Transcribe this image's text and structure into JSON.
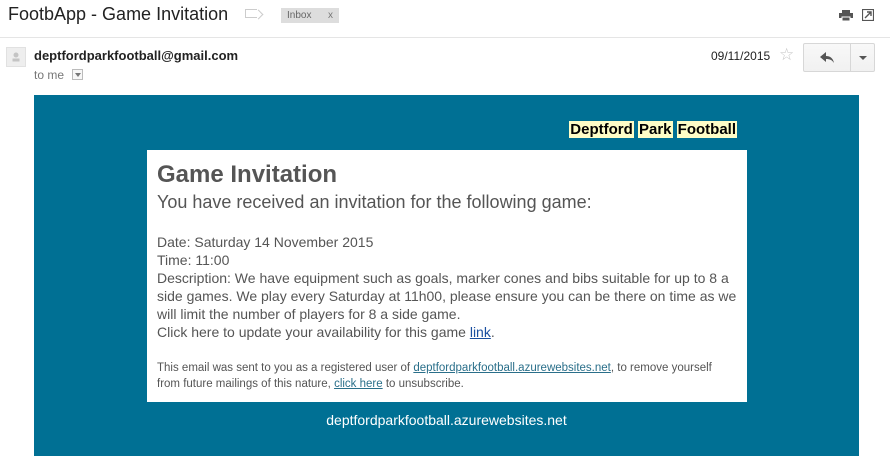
{
  "header": {
    "subject": "FootbApp - Game Invitation",
    "label_chip": "Inbox",
    "label_chip_remove": "x"
  },
  "message": {
    "sender": "deptfordparkfootball@gmail.com",
    "recipient": "to me",
    "date": "09/11/2015",
    "star": "☆"
  },
  "email": {
    "brand_words": [
      "Deptford",
      "Park",
      "Football"
    ],
    "title": "Game Invitation",
    "subtitle": "You have received an invitation for the following game:",
    "date_line": "Date: Saturday 14 November 2015",
    "time_line": "Time: 11:00",
    "description": "Description: We have equipment such as goals, marker cones and bibs suitable for up to 8 a side games. We play every Saturday at 11h00, please ensure you can be there on time as we will limit the number of players for 8 a side game.",
    "update_prefix": "Click here to update your availability for this game ",
    "update_link": "link",
    "update_suffix": ".",
    "footer_prefix": "This email was sent to you as a registered user of ",
    "footer_site_link": "deptfordparkfootball.azurewebsites.net",
    "footer_middle": ", to remove yourself from future mailings of this nature, ",
    "footer_click_here": "click here",
    "footer_suffix": " to unsubscribe.",
    "site_url": "deptfordparkfootball.azurewebsites.net"
  },
  "colors": {
    "frame": "#007094",
    "brand_highlight": "#fefdc7",
    "card": "#ffffff"
  }
}
